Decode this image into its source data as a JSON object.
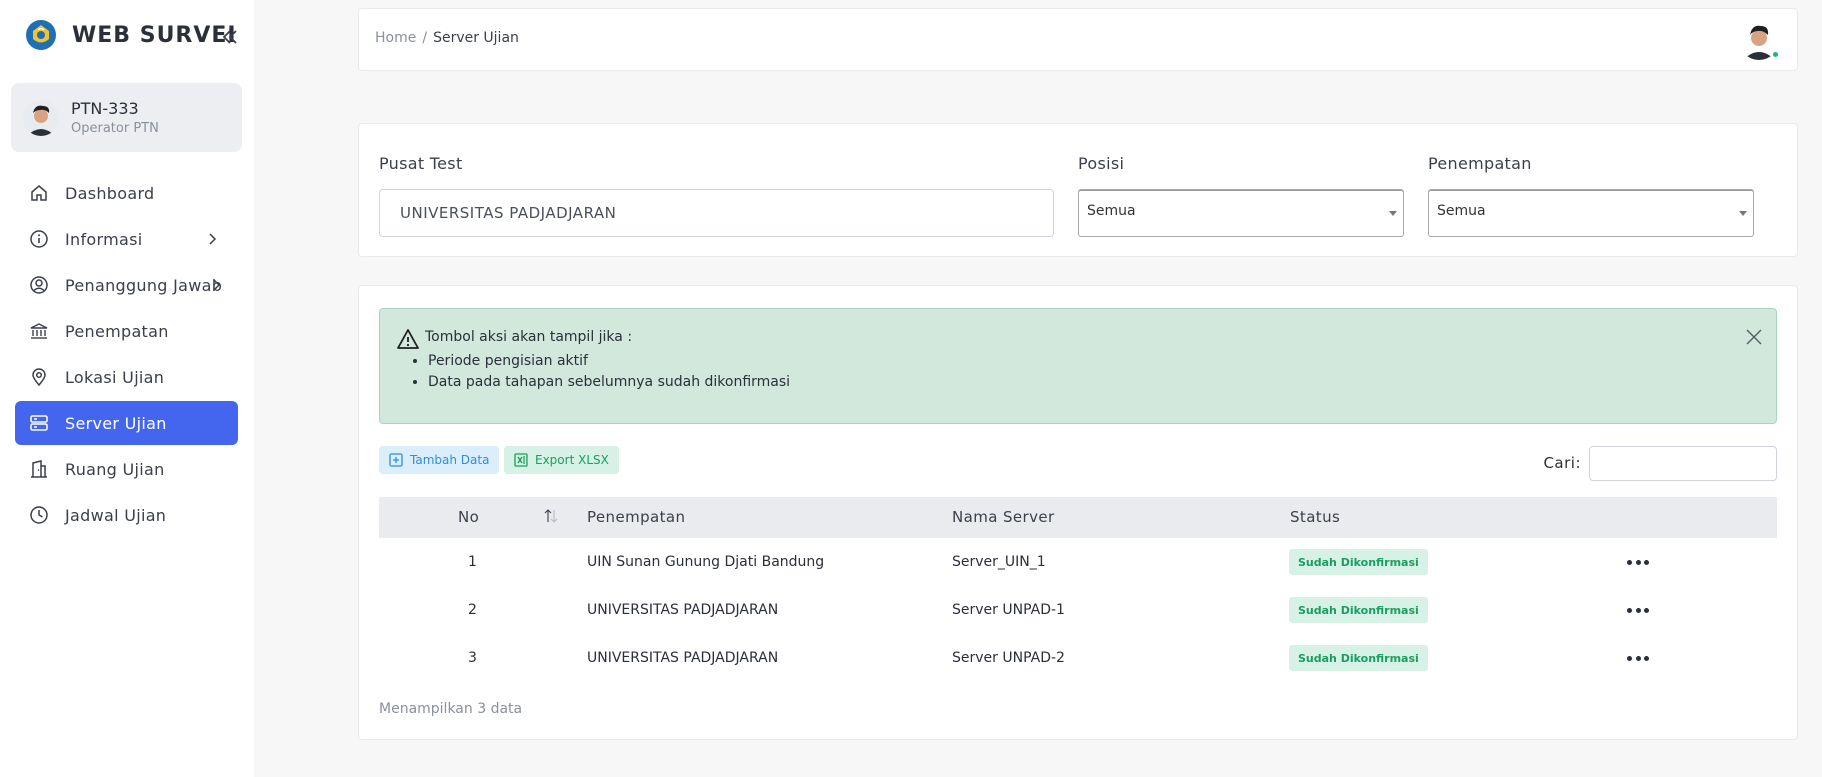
{
  "brand": {
    "title": "WEB SURVEI",
    "logo_icon": "tut-wuri-logo-icon"
  },
  "user": {
    "name": "PTN-333",
    "role": "Operator PTN"
  },
  "nav": {
    "items": [
      {
        "label": "Dashboard",
        "icon": "home-icon"
      },
      {
        "label": "Informasi",
        "icon": "info-icon"
      },
      {
        "label": "Penanggung Jawab",
        "icon": "user-circle-icon"
      },
      {
        "label": "Penempatan",
        "icon": "bank-icon"
      },
      {
        "label": "Lokasi Ujian",
        "icon": "map-pin-icon"
      },
      {
        "label": "Server Ujian",
        "icon": "server-icon"
      },
      {
        "label": "Ruang Ujian",
        "icon": "building-icon"
      },
      {
        "label": "Jadwal Ujian",
        "icon": "clock-icon"
      }
    ],
    "active": "Server Ujian"
  },
  "breadcrumb": {
    "home": "Home",
    "separator": "/",
    "current": "Server Ujian"
  },
  "filters": {
    "pusat_test": {
      "label": "Pusat Test",
      "value": "UNIVERSITAS PADJADJARAN"
    },
    "posisi": {
      "label": "Posisi",
      "value": "Semua"
    },
    "penempatan": {
      "label": "Penempatan",
      "value": "Semua"
    }
  },
  "alert": {
    "title": "Tombol aksi akan tampil jika :",
    "items": [
      "Periode pengisian aktif",
      "Data pada tahapan sebelumnya sudah dikonfirmasi"
    ]
  },
  "actions": {
    "add": "Tambah Data",
    "export": "Export XLSX"
  },
  "search": {
    "label": "Cari:",
    "value": ""
  },
  "table": {
    "headers": {
      "no": "No",
      "penempatan": "Penempatan",
      "nama_server": "Nama Server",
      "status": "Status"
    },
    "rows": [
      {
        "no": "1",
        "penempatan": "UIN Sunan Gunung Djati Bandung",
        "nama_server": "Server_UIN_1",
        "status": "Sudah Dikonfirmasi"
      },
      {
        "no": "2",
        "penempatan": "UNIVERSITAS PADJADJARAN",
        "nama_server": "Server UNPAD-1",
        "status": "Sudah Dikonfirmasi"
      },
      {
        "no": "3",
        "penempatan": "UNIVERSITAS PADJADJARAN",
        "nama_server": "Server UNPAD-2",
        "status": "Sudah Dikonfirmasi"
      }
    ]
  },
  "footer": {
    "info": "Menampilkan 3 data"
  },
  "colors": {
    "accent": "#4466ee",
    "success": "#18a05e",
    "info": "#2f8fd4",
    "alert_bg": "#d2e8dd"
  }
}
